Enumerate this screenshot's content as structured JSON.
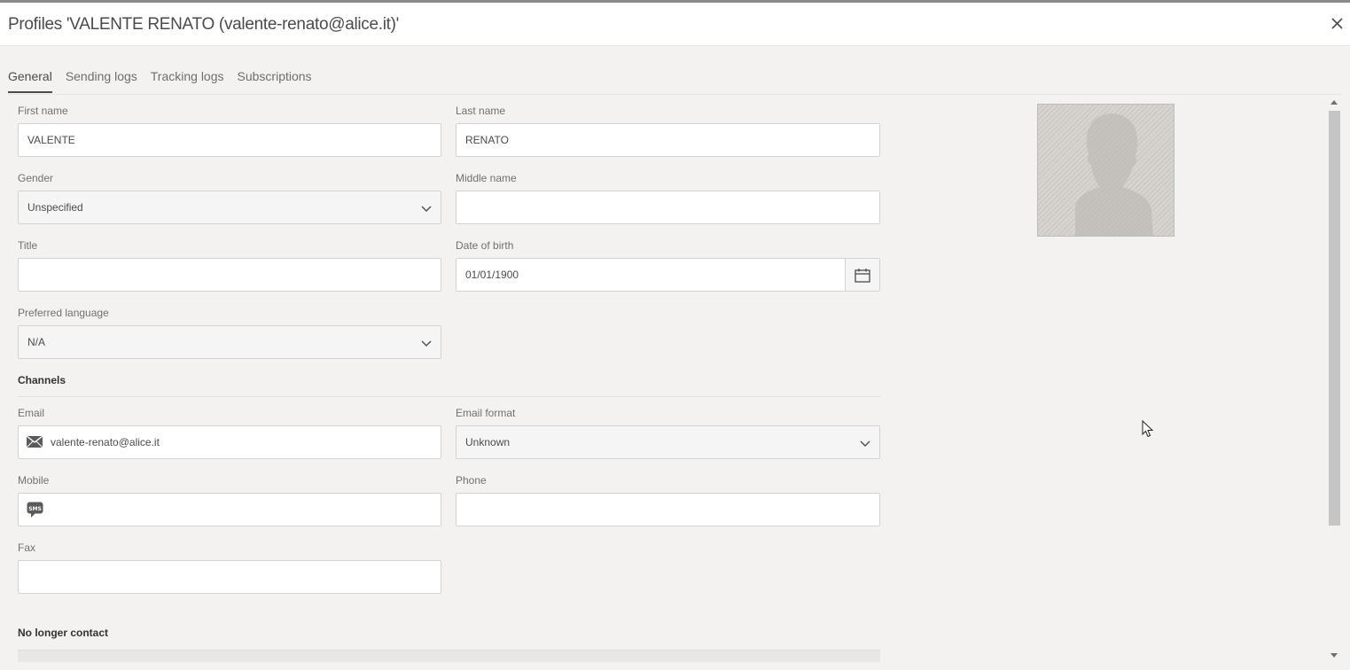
{
  "window": {
    "title": "Profiles 'VALENTE RENATO (valente-renato@alice.it)'",
    "close_icon": "close-icon"
  },
  "tabs": [
    {
      "label": "General",
      "active": true
    },
    {
      "label": "Sending logs",
      "active": false
    },
    {
      "label": "Tracking logs",
      "active": false
    },
    {
      "label": "Subscriptions",
      "active": false
    }
  ],
  "form": {
    "first_name": {
      "label": "First name",
      "value": "VALENTE"
    },
    "last_name": {
      "label": "Last name",
      "value": "RENATO"
    },
    "gender": {
      "label": "Gender",
      "value": "Unspecified"
    },
    "middle_name": {
      "label": "Middle name",
      "value": ""
    },
    "title": {
      "label": "Title",
      "value": ""
    },
    "date_of_birth": {
      "label": "Date of birth",
      "value": "01/01/1900"
    },
    "preferred_language": {
      "label": "Preferred language",
      "value": "N/A"
    }
  },
  "channels": {
    "heading": "Channels",
    "email": {
      "label": "Email",
      "value": "valente-renato@alice.it"
    },
    "email_format": {
      "label": "Email format",
      "value": "Unknown"
    },
    "mobile": {
      "label": "Mobile",
      "value": ""
    },
    "phone": {
      "label": "Phone",
      "value": ""
    },
    "fax": {
      "label": "Fax",
      "value": ""
    }
  },
  "no_longer_contact": {
    "heading": "No longer contact"
  },
  "icons": {
    "envelope": "envelope-icon",
    "sms": "sms-icon",
    "calendar": "calendar-icon",
    "chevron": "chevron-down-icon",
    "avatar": "avatar-placeholder"
  },
  "colors": {
    "background": "#f3f2f0",
    "field_bg": "#ffffff",
    "select_bg": "#f5f5f5",
    "border": "#d3d3d3",
    "text": "#4b4b4b",
    "label": "#707070"
  }
}
